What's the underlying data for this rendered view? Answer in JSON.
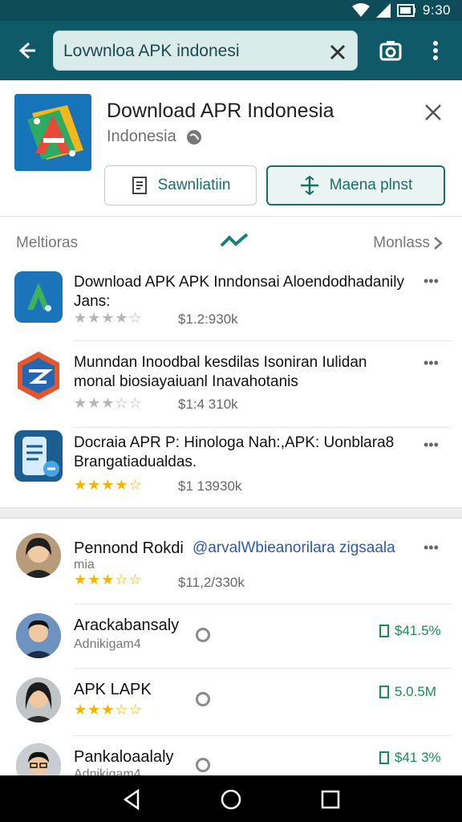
{
  "status": {
    "time": "9:30"
  },
  "search": {
    "query": "Lovwnloa APK indonesi"
  },
  "header": {
    "title": "Download APR Indonesia",
    "subtitle": "Indonesia",
    "button1": "Sawnliatiin",
    "button2": "Maena plnst"
  },
  "section": {
    "left": "Meltioras",
    "right": "Monlass"
  },
  "apps": [
    {
      "title": "Download APK APK Inndonsai Alоendodhadanily Jans:",
      "rating": "★★★★☆",
      "price": "$1.2:930k"
    },
    {
      "title": "Munndan Inoodbal kesdilas Isoniran Iulidan monal biosiayaiuanl Inavahotanis",
      "rating": "★★★☆☆",
      "price": "$1:4 310k"
    },
    {
      "title": "Docraia APR P: Hinologa Nah:,APK: Uonblara8 Brangatiadualdas.",
      "rating": "★★★★☆",
      "price": "$1 13930k"
    }
  ],
  "people": [
    {
      "name": "Pennond Rokdi",
      "link": "@arvalWbieanorilara zigsaala",
      "sub": "mia",
      "rating": "★★★☆☆",
      "price": "$11,2/330k"
    },
    {
      "name": "Arackabansaly",
      "sub": "Adnikigam4",
      "size": "$41.5%"
    },
    {
      "name": "APK LAPK",
      "rating": "★★★☆☆",
      "size": "5.0.5M"
    },
    {
      "name": "Pankaloaalaly",
      "sub": "Adnikigam4",
      "size": "$41 3%"
    }
  ],
  "colors": {
    "primary": "#0f5a69",
    "accent": "#1a6e62",
    "star": "#f5b400"
  }
}
